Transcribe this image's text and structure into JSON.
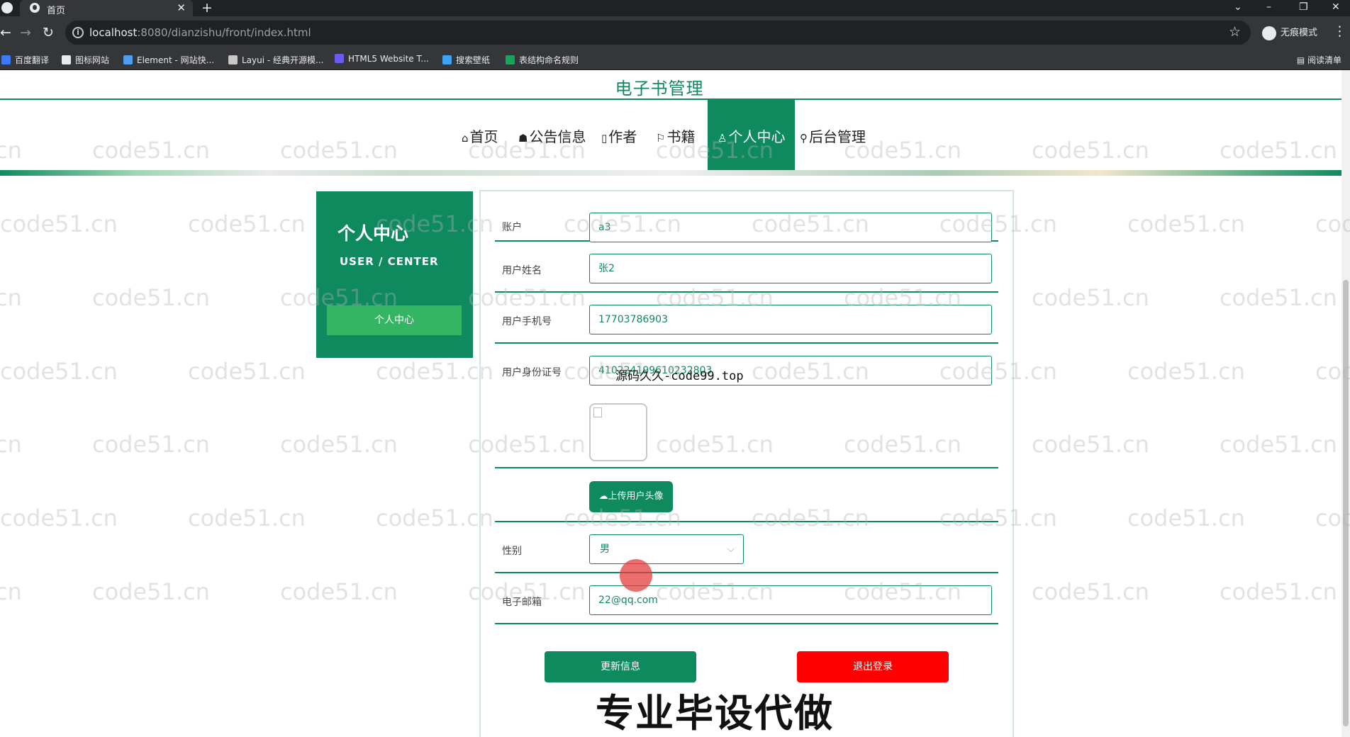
{
  "browser": {
    "tab_title": "首页",
    "url_host": "localhost",
    "url_path": ":8080/dianzishu/front/index.html",
    "incognito_label": "无痕模式",
    "reading_list": "阅读清单",
    "bookmarks": [
      {
        "label": "百度翻译",
        "color": "#3b7cf4"
      },
      {
        "label": "图标网站",
        "color": "#e8eaed"
      },
      {
        "label": "Element - 网站快...",
        "color": "#4c9ef0"
      },
      {
        "label": "Layui - 经典开源模...",
        "color": "#c8c8c8"
      },
      {
        "label": "HTML5 Website T...",
        "color": "#6a5cf0"
      },
      {
        "label": "搜索壁纸",
        "color": "#3fa3f5"
      },
      {
        "label": "表结构命名规则",
        "color": "#1aa35a"
      }
    ]
  },
  "site": {
    "title": "电子书管理",
    "nav": [
      {
        "icon": "⌂",
        "label": "首页"
      },
      {
        "icon": "☗",
        "label": "公告信息"
      },
      {
        "icon": "▯",
        "label": "作者"
      },
      {
        "icon": "⚐",
        "label": "书籍"
      },
      {
        "icon": "♙",
        "label": "个人中心"
      },
      {
        "icon": "⚲",
        "label": "后台管理"
      }
    ]
  },
  "sidebar": {
    "title": "个人中心",
    "subtitle": "USER / CENTER",
    "item": "个人中心"
  },
  "form": {
    "account_label": "账户",
    "account_value": "a3",
    "name_label": "用户姓名",
    "name_value": "张2",
    "phone_label": "用户手机号",
    "phone_value": "17703786903",
    "idcard_label": "用户身份证号",
    "idcard_value": "410224199610232803",
    "upload_label": "上传用户头像",
    "gender_label": "性别",
    "gender_value": "男",
    "email_label": "电子邮箱",
    "email_value": "22@qq.com",
    "update_button": "更新信息",
    "logout_button": "退出登录"
  },
  "overlays": {
    "watermark": "code51.cn",
    "source_text": "源码久久-code99.top",
    "ad_text": "专业毕设代做"
  },
  "colors": {
    "brand": "#0f8a5f",
    "upload_hover": "#33b563",
    "logout": "#ff0000"
  }
}
